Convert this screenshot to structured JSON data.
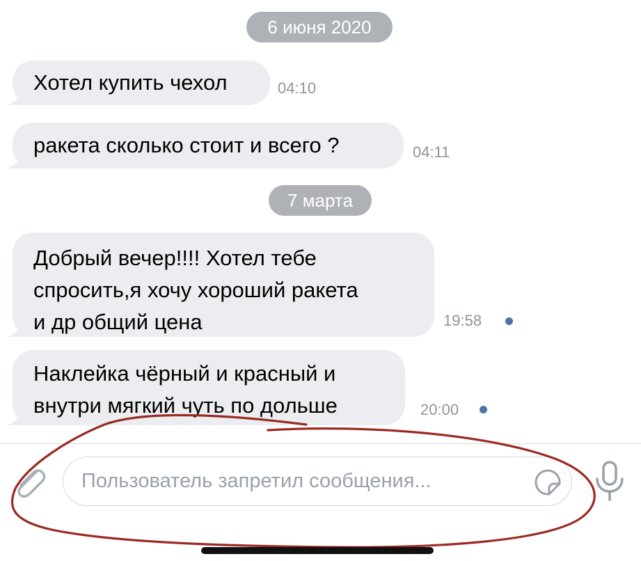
{
  "chat": {
    "date_1": "6 июня 2020",
    "date_2": "7 марта",
    "messages": [
      {
        "lines": [
          "Хотел купить чехол"
        ],
        "time": "04:10"
      },
      {
        "lines": [
          "ракета сколько стоит и всего ?"
        ],
        "time": "04:11"
      },
      {
        "lines": [
          "Добрый вечер!!!! Хотел тебе",
          "спросить,я хочу хороший ракета",
          "и др общий цена"
        ],
        "time": "19:58"
      },
      {
        "lines": [
          "Наклейка чёрный и красный и",
          "внутри мягкий чуть по дольше"
        ],
        "time": "20:00"
      }
    ]
  },
  "composer": {
    "placeholder": "Пользователь запретил сообщения..."
  },
  "icons": {
    "attach": "paperclip-icon",
    "sticker": "sticker-icon",
    "mic": "microphone-icon"
  },
  "colors": {
    "bubble": "#ebedf0",
    "date_pill": "#aeb1b6",
    "unread_dot": "#4a76a8",
    "annotation": "#9b2a22"
  }
}
